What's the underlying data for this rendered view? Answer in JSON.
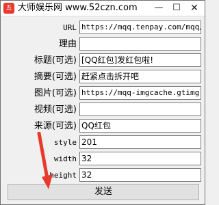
{
  "window": {
    "icon_text": "五",
    "title": "大师娱乐网 www.52czn.com",
    "min_glyph": "—",
    "max_glyph": "☐",
    "close_glyph": "✕"
  },
  "form": {
    "fields": [
      {
        "label": "URL",
        "value": "https://mqq.tenpay.com/mqq/hongbao/"
      },
      {
        "label": "理由",
        "value": ""
      },
      {
        "label": "标题(可选)",
        "value": "[QQ红包]发红包啦!"
      },
      {
        "label": "摘要(可选)",
        "value": "赶紧点击拆开吧"
      },
      {
        "label": "图片(可选)",
        "value": "https://mqq-imgcache.gtimg.cn/res/"
      },
      {
        "label": "视频(可选)",
        "value": ""
      },
      {
        "label": "来源(可选)",
        "value": "QQ红包"
      },
      {
        "label": "style",
        "value": "201"
      },
      {
        "label": "width",
        "value": "32"
      },
      {
        "label": "height",
        "value": "32"
      }
    ],
    "submit_label": "发送"
  },
  "colors": {
    "arrow": "#e8392c"
  }
}
